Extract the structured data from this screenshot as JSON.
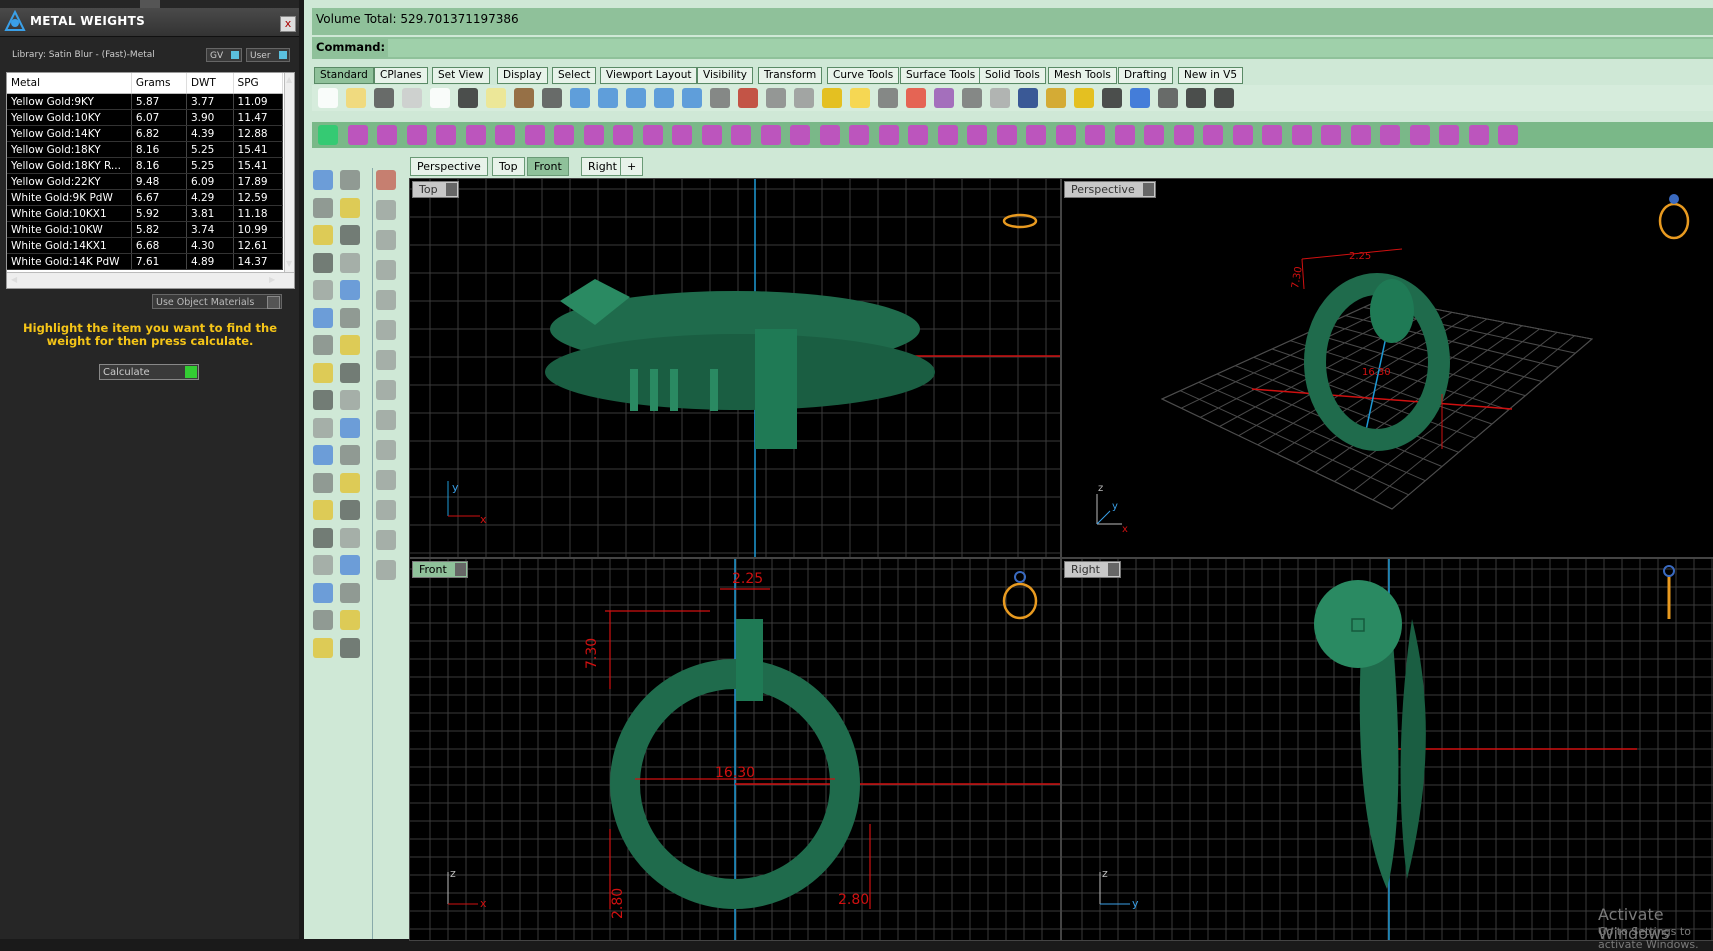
{
  "panel": {
    "title": "METAL WEIGHTS",
    "close": "x",
    "library": "Library: Satin Blur - (Fast)-Metal",
    "gv": "GV",
    "user": "User",
    "columns": [
      "Metal",
      "Grams",
      "DWT",
      "SPG"
    ],
    "rows": [
      [
        "Yellow Gold:9KY",
        "5.87",
        "3.77",
        "11.09"
      ],
      [
        "Yellow Gold:10KY",
        "6.07",
        "3.90",
        "11.47"
      ],
      [
        "Yellow Gold:14KY",
        "6.82",
        "4.39",
        "12.88"
      ],
      [
        "Yellow Gold:18KY",
        "8.16",
        "5.25",
        "15.41"
      ],
      [
        "Yellow Gold:18KY R...",
        "8.16",
        "5.25",
        "15.41"
      ],
      [
        "Yellow Gold:22KY",
        "9.48",
        "6.09",
        "17.89"
      ],
      [
        "White Gold:9K PdW",
        "6.67",
        "4.29",
        "12.59"
      ],
      [
        "White Gold:10KX1",
        "5.92",
        "3.81",
        "11.18"
      ],
      [
        "White Gold:10KW",
        "5.82",
        "3.74",
        "10.99"
      ],
      [
        "White Gold:14KX1",
        "6.68",
        "4.30",
        "12.61"
      ],
      [
        "White Gold:14K PdW",
        "7.61",
        "4.89",
        "14.37"
      ]
    ],
    "use_object_materials": "Use Object Materials",
    "hint": "Highlight the item you want to find the weight for then press calculate.",
    "calculate": "Calculate"
  },
  "rhino": {
    "status": "Volume Total: 529.701371197386",
    "command_label": "Command:",
    "tabs": [
      "Standard",
      "CPlanes",
      "Set View",
      "Display",
      "Select",
      "Viewport Layout",
      "Visibility",
      "Transform",
      "Curve Tools",
      "Surface Tools",
      "Solid Tools",
      "Mesh Tools",
      "Drafting",
      "New in V5"
    ],
    "viewport_tabs": [
      "Perspective",
      "Top",
      "Front",
      "Right",
      "+"
    ],
    "viewports": {
      "top": "Top",
      "perspective": "Perspective",
      "front": "Front",
      "right": "Right"
    },
    "dimensions": {
      "width_top": "2.25",
      "height": "7.30",
      "diameter": "16.30",
      "thickness_left": "2.80",
      "thickness_right": "2.80"
    },
    "axes": {
      "x": "x",
      "y": "y",
      "z": "z"
    },
    "watermark_title": "Activate Windows",
    "watermark_sub": "Go to Settings to activate Windows."
  },
  "colors": {
    "accent": "#8fc19a",
    "model": "#1f6b4c",
    "dimension": "#ff2020"
  }
}
